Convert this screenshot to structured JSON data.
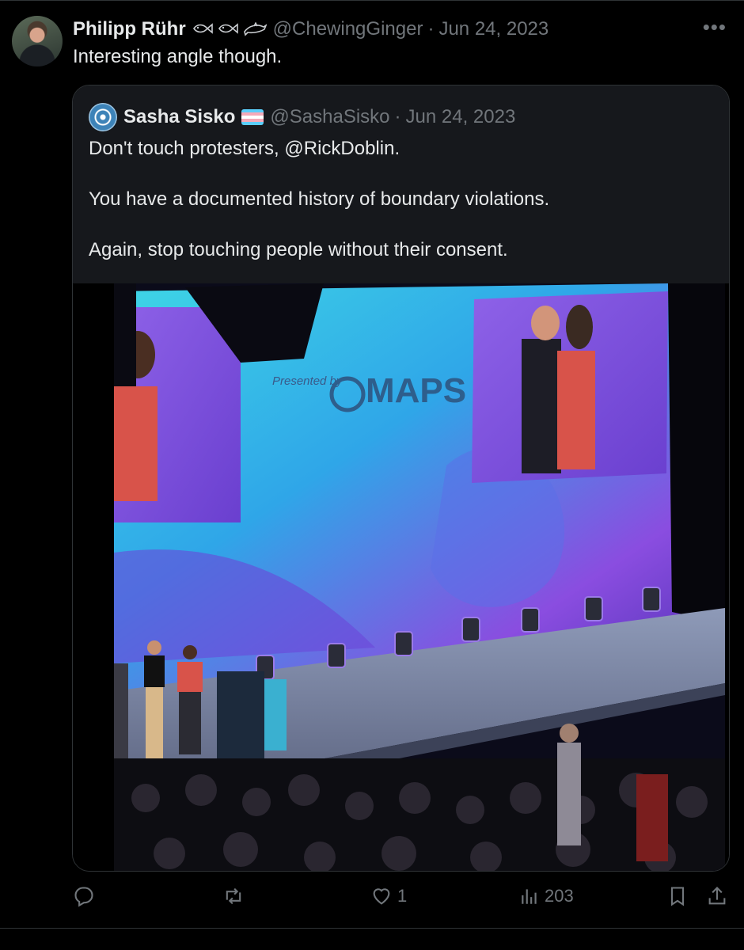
{
  "tweet": {
    "author_name": "Philipp Rühr",
    "author_emojis": [
      "fish-icon",
      "fish-icon",
      "dolphin-icon"
    ],
    "handle": "@ChewingGinger",
    "separator": "·",
    "date": "Jun 24, 2023",
    "more_icon": "more-dots-icon",
    "text": "Interesting angle though."
  },
  "quote": {
    "author_name": "Sasha Sisko",
    "flag_icon": "transgender-flag-icon",
    "handle": "@SashaSisko",
    "separator": "·",
    "date": "Jun 24, 2023",
    "lines": [
      "Don't touch protesters, @RickDoblin.",
      "You have a documented history of boundary violations.",
      "Again, stop touching people without their consent."
    ],
    "media": {
      "type": "video",
      "screen_text_presented": "Presented by",
      "screen_text_brand": "MAPS"
    }
  },
  "actions": {
    "reply": {
      "icon": "reply-icon",
      "count": ""
    },
    "retweet": {
      "icon": "retweet-icon",
      "count": ""
    },
    "like": {
      "icon": "heart-icon",
      "count": "1"
    },
    "views": {
      "icon": "views-icon",
      "count": "203"
    },
    "bookmark": {
      "icon": "bookmark-icon"
    },
    "share": {
      "icon": "share-icon"
    }
  },
  "colors": {
    "background": "#000000",
    "quote_background": "#16181c",
    "text_primary": "#e7e9ea",
    "text_secondary": "#71767b",
    "border": "#2f3336"
  }
}
